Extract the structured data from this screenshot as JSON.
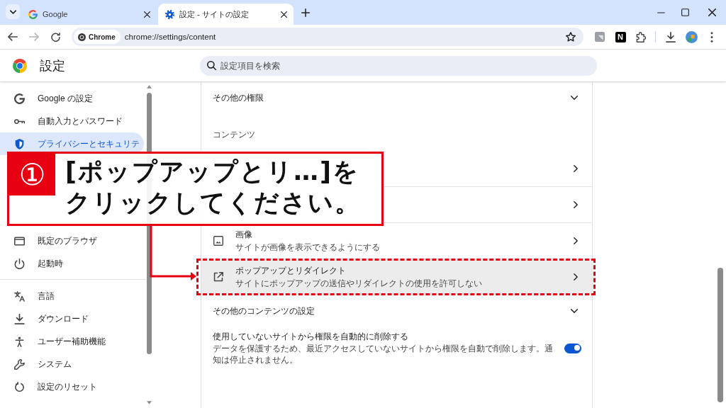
{
  "tab_strip": {
    "tabs": [
      {
        "title": "Google",
        "selected": false
      },
      {
        "title": "設定 - サイトの設定",
        "selected": true
      }
    ]
  },
  "toolbar": {
    "back_disabled": false,
    "forward_disabled": true,
    "site_chip": "Chrome",
    "url": "chrome://settings/content",
    "extension_letter": "N"
  },
  "settings_header": {
    "title": "設定",
    "search": {
      "placeholder": "設定項目を検索"
    }
  },
  "sidebar": {
    "groups": [
      {
        "items": [
          {
            "label": "Google の設定",
            "selected": false
          },
          {
            "label": "自動入力とパスワード",
            "selected": false
          },
          {
            "label": "プライバシーとセキュリテ",
            "selected": true
          }
        ]
      },
      {
        "items": [
          {
            "label": "既定のブラウザ",
            "selected": false
          },
          {
            "label": "起動時",
            "selected": false
          }
        ]
      },
      {
        "items": [
          {
            "label": "言語",
            "selected": false
          },
          {
            "label": "ダウンロード",
            "selected": false
          },
          {
            "label": "ユーザー補助機能",
            "selected": false
          },
          {
            "label": "システム",
            "selected": false
          },
          {
            "label": "設定のリセット",
            "selected": false
          }
        ]
      }
    ]
  },
  "content": {
    "rows": [
      {
        "kind": "expander",
        "title": "その他の権限",
        "expanded": false
      },
      {
        "kind": "heading",
        "title": "コンテンツ"
      },
      {
        "kind": "link",
        "hovered": false
      },
      {
        "kind": "link",
        "hovered": false
      },
      {
        "kind": "link",
        "title": "画像",
        "subtitle": "サイトが画像を表示できるようにする",
        "hovered": false
      },
      {
        "kind": "link",
        "title": "ポップアップとリダイレクト",
        "subtitle": "サイトにポップアップの送信やリダイレクトの使用を許可しない",
        "hovered": true
      },
      {
        "kind": "expander",
        "title": "その他のコンテンツの設定",
        "expanded": false
      },
      {
        "kind": "toggle",
        "title": "使用していないサイトから権限を自動的に削除する",
        "subtitle": "データを保護するため、最近アクセスしていないサイトから権限を自動で削除します。通知は停止されません。",
        "on": true
      }
    ]
  },
  "callout": {
    "number": "①",
    "lines": [
      "[ポップアップとリ…]を",
      "クリックしてください。"
    ]
  }
}
